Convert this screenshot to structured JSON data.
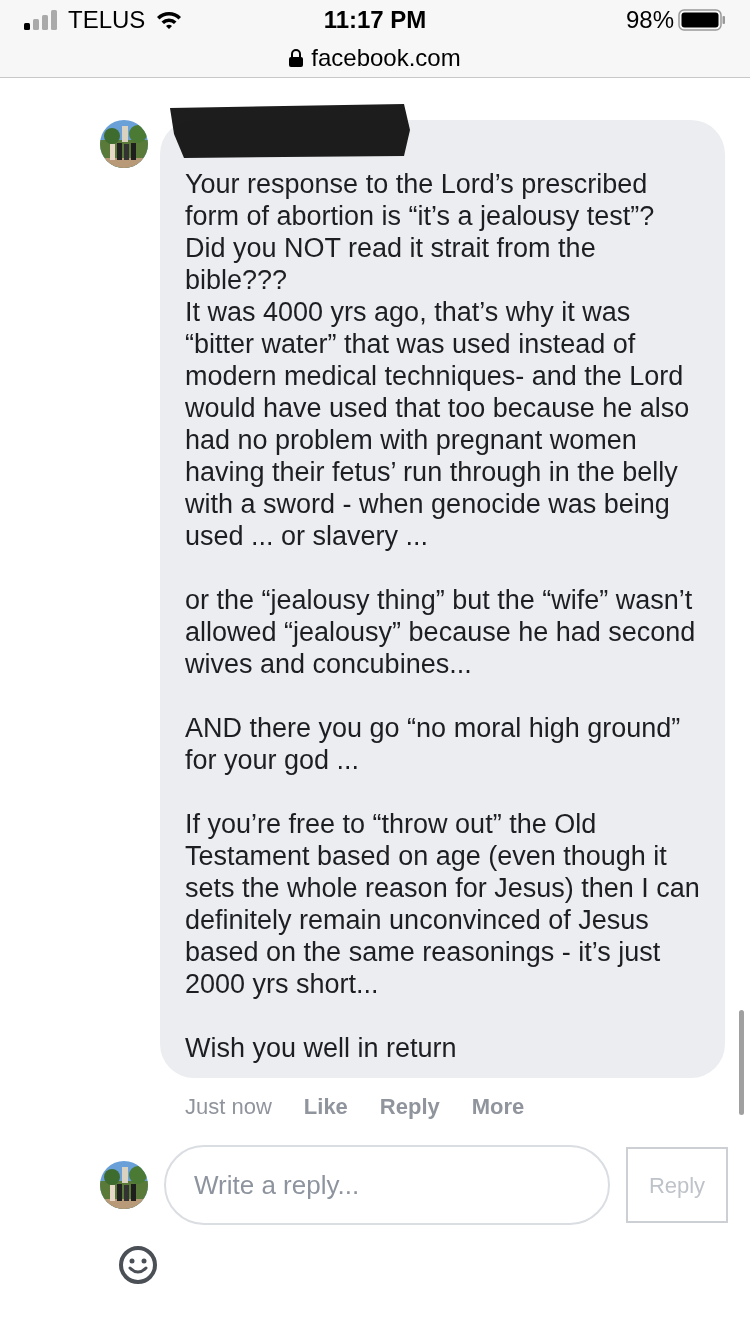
{
  "status_bar": {
    "carrier": "TELUS",
    "time": "11:17 PM",
    "battery": "98%"
  },
  "address_bar": {
    "url": "facebook.com"
  },
  "comment": {
    "blocks": [
      [
        "Your response to the Lord’s prescribed form of abortion is “it’s a jealousy test”? Did you NOT read it strait from the bible???",
        "It was 4000 yrs ago, that’s why it was “bitter water” that was used instead of modern medical techniques- and the Lord would have used that too because he also had no problem with pregnant women having their fetus’ run through in the belly with a sword - when genocide was being used ... or slavery ..."
      ],
      [
        "or the “jealousy thing” but the “wife” wasn’t allowed “jealousy” because he had second wives and concubines..."
      ],
      [
        "AND there you go “no moral high ground” for your god ..."
      ],
      [
        "If you’re free to “throw out” the Old Testament based on age (even though it sets the whole reason for Jesus) then I can definitely remain unconvinced of Jesus based on the same reasonings - it’s just 2000 yrs short..."
      ],
      [
        "Wish you well in return"
      ]
    ],
    "timestamp": "Just now",
    "actions": [
      "Like",
      "Reply",
      "More"
    ]
  },
  "reply_box": {
    "placeholder": "Write a reply...",
    "button": "Reply"
  }
}
